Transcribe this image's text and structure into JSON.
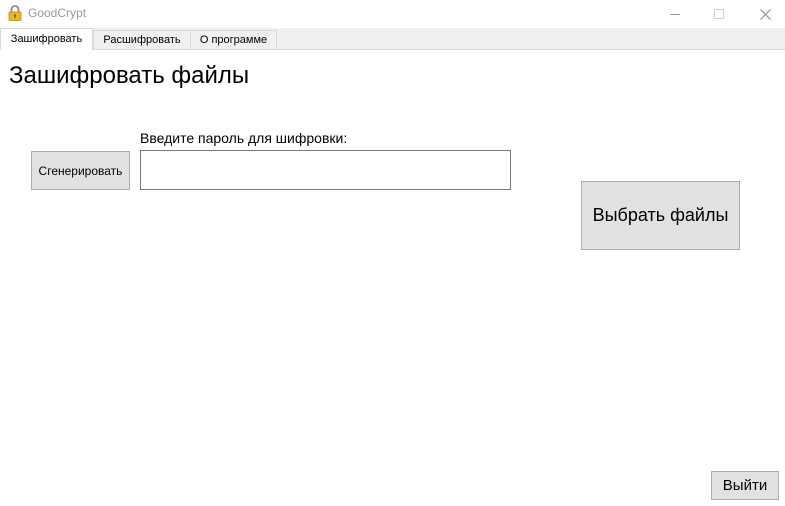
{
  "window": {
    "title": "GoodCrypt",
    "icon": "padlock-icon"
  },
  "window_controls": {
    "minimize_icon": "minimize-icon",
    "maximize_icon": "maximize-icon",
    "close_icon": "close-icon"
  },
  "tabs": [
    {
      "label": "Зашифровать",
      "active": true
    },
    {
      "label": "Расшифровать",
      "active": false
    },
    {
      "label": "О программе",
      "active": false
    }
  ],
  "main": {
    "title": "Зашифровать файлы",
    "generate_button": "Сгенерировать",
    "password_label": "Введите пароль для шифровки:",
    "password_value": "",
    "choose_files_button": "Выбрать файлы",
    "exit_button": "Выйти"
  }
}
